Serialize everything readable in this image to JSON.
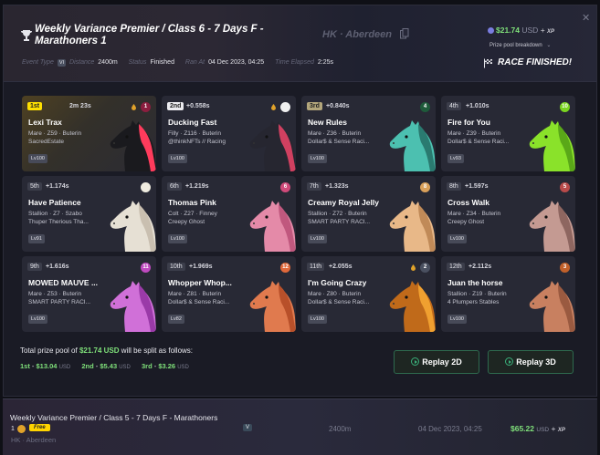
{
  "race": {
    "title": "Weekly Variance Premier / Class 6 - 7 Days F - Marathoners 1",
    "location": "HK · Aberdeen",
    "prize_amount": "$21.74",
    "prize_currency": "USD",
    "prize_plus": "+",
    "xp_label": "XP",
    "prize_breakdown_label": "Prize pool breakdown",
    "close_label": "✕",
    "status_banner": "RACE FINISHED!",
    "meta": {
      "event_type_label": "Event Type",
      "event_type_value": "VI",
      "distance_label": "Distance",
      "distance_value": "2400m",
      "status_label": "Status",
      "status_value": "Finished",
      "ran_at_label": "Ran At",
      "ran_at_value": "04 Dec 2023, 04:25",
      "elapsed_label": "Time Elapsed",
      "elapsed_value": "2:25s"
    }
  },
  "results": [
    {
      "pos": "1st",
      "gap": "2m 23s",
      "name": "Lexi Trax",
      "line1": "Mare · Z59 · Buterin",
      "line2": "SacredEstate",
      "level": "Lv100",
      "gate": "1",
      "gate_color": "#8b1e3f",
      "coat": "#1a1a1e",
      "mane": "#ff3b5c",
      "drop": true
    },
    {
      "pos": "2nd",
      "gap": "+0.558s",
      "name": "Ducking Fast",
      "line1": "Filly · Z116 · Buterin",
      "line2": "@thinkNFTs // Racing",
      "level": "Lv100",
      "gate": "",
      "gate_color": "#f0f0f0",
      "coat": "#262630",
      "mane": "#d04060",
      "drop": true
    },
    {
      "pos": "3rd",
      "gap": "+0.840s",
      "name": "New Rules",
      "line1": "Mare · Z36 · Buterin",
      "line2": "Dollar$ & Sense Raci...",
      "level": "Lv100",
      "gate": "4",
      "gate_color": "#1e5a3a",
      "coat": "#4cc0b0",
      "mane": "#2a7a70",
      "drop": false
    },
    {
      "pos": "4th",
      "gap": "+1.010s",
      "name": "Fire for You",
      "line1": "Mare · Z39 · Buterin",
      "line2": "Dollar$ & Sense Raci...",
      "level": "Lv93",
      "gate": "10",
      "gate_color": "#7ad420",
      "coat": "#8ae22a",
      "mane": "#5aa818",
      "drop": false
    },
    {
      "pos": "5th",
      "gap": "+1.174s",
      "name": "Have Patience",
      "line1": "Stallion · Z7 · Szabo",
      "line2": "Thuper Therious Tha...",
      "level": "Lv91",
      "gate": "",
      "gate_color": "#f0ece0",
      "coat": "#e6e0d4",
      "mane": "#c9bfb0",
      "drop": false
    },
    {
      "pos": "6th",
      "gap": "+1.219s",
      "name": "Thomas Pink",
      "line1": "Colt · Z27 · Finney",
      "line2": "Creepy Ghost",
      "level": "Lv100",
      "gate": "6",
      "gate_color": "#d04a7a",
      "coat": "#e48aa8",
      "mane": "#c0587e",
      "drop": false
    },
    {
      "pos": "7th",
      "gap": "+1.323s",
      "name": "Creamy Royal Jelly",
      "line1": "Stallion · Z72 · Buterin",
      "line2": "SMART PARTY RACI...",
      "level": "Lv100",
      "gate": "8",
      "gate_color": "#d9a05a",
      "coat": "#e8b888",
      "mane": "#c08a58",
      "drop": false
    },
    {
      "pos": "8th",
      "gap": "+1.597s",
      "name": "Cross Walk",
      "line1": "Mare · Z34 · Buterin",
      "line2": "Creepy Ghost",
      "level": "Lv100",
      "gate": "5",
      "gate_color": "#b84a4a",
      "coat": "#c49a92",
      "mane": "#8e6660",
      "drop": false
    },
    {
      "pos": "9th",
      "gap": "+1.616s",
      "name": "MOWED MAUVE ...",
      "line1": "Mare · Z53 · Buterin",
      "line2": "SMART PARTY RACI...",
      "level": "Lv100",
      "gate": "11",
      "gate_color": "#c04ac0",
      "coat": "#d070d8",
      "mane": "#9a3aa8",
      "drop": false
    },
    {
      "pos": "10th",
      "gap": "+1.969s",
      "name": "Whopper Whop...",
      "line1": "Mare · Z81 · Buterin",
      "line2": "Dollar$ & Sense Raci...",
      "level": "Lv82",
      "gate": "12",
      "gate_color": "#e0683a",
      "coat": "#e07a4e",
      "mane": "#b8502a",
      "drop": false
    },
    {
      "pos": "11th",
      "gap": "+2.055s",
      "name": "I'm Going Crazy",
      "line1": "Mare · Z80 · Buterin",
      "line2": "Dollar$ & Sense Raci...",
      "level": "Lv100",
      "gate": "2",
      "gate_color": "#4a5060",
      "coat": "#c06a1a",
      "mane": "#f0a030",
      "drop": true
    },
    {
      "pos": "12th",
      "gap": "+2.112s",
      "name": "Juan the horse",
      "line1": "Stallion · Z19 · Buterin",
      "line2": "4 Plumpers Stables",
      "level": "Lv100",
      "gate": "3",
      "gate_color": "#c0602a",
      "coat": "#c88060",
      "mane": "#9a5a40",
      "drop": false
    }
  ],
  "pool": {
    "intro": "Total prize pool of",
    "amount": "$21.74 USD",
    "outro": "will be split as follows:",
    "first_label": "1st",
    "first_amount": "$13.04",
    "second_label": "2nd",
    "second_amount": "$5.43",
    "third_label": "3rd",
    "third_amount": "$3.26",
    "unit": "USD"
  },
  "buttons": {
    "replay_2d": "Replay 2D",
    "replay_3d": "Replay 3D"
  },
  "next_race": {
    "title": "Weekly Variance Premier / Class 5 - 7 Days F - Marathoners",
    "number": "1",
    "free_label": "Free",
    "location": "HK · Aberdeen",
    "event_badge": "V",
    "distance": "2400m",
    "date": "04 Dec 2023, 04:25",
    "prize_amount": "$65.22",
    "prize_currency": "USD",
    "prize_plus": "+",
    "xp_label": "XP"
  }
}
